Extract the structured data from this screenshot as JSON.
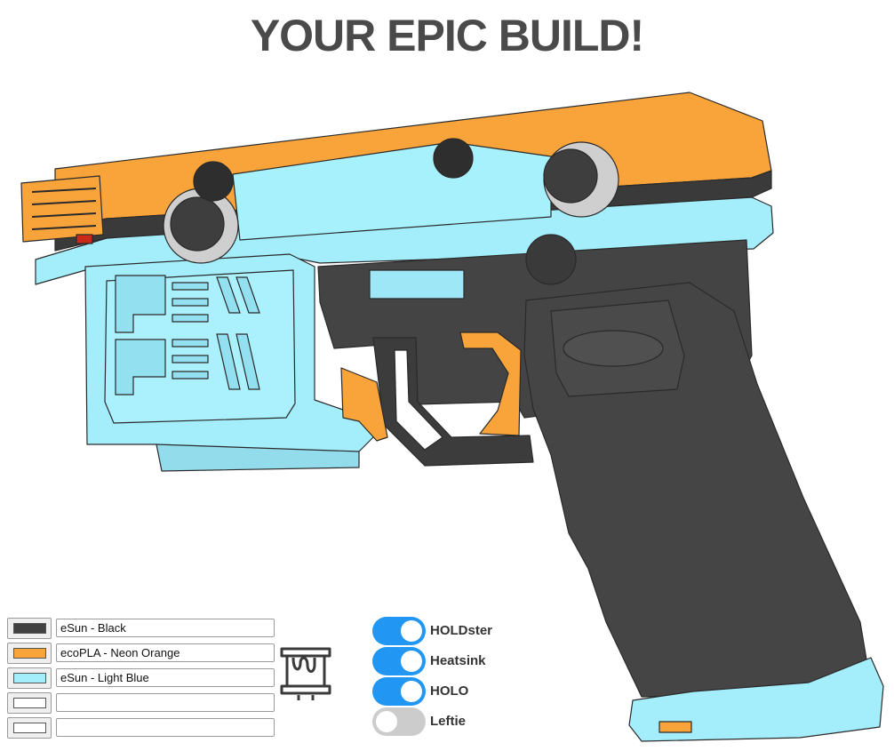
{
  "page": {
    "title": "YOUR EPIC BUILD!"
  },
  "colors": {
    "black": "#414141",
    "orange": "#f9a43b",
    "light_blue": "#a4eefc",
    "empty": "#ffffff"
  },
  "filaments": [
    {
      "name": "eSun - Black",
      "color": "#414141"
    },
    {
      "name": "ecoPLA - Neon Orange",
      "color": "#f9a43b"
    },
    {
      "name": "eSun - Light Blue",
      "color": "#a4eefc"
    },
    {
      "name": "",
      "color": "#ffffff"
    },
    {
      "name": "",
      "color": "#ffffff"
    }
  ],
  "spool_icon": "filament-spool-icon",
  "options": [
    {
      "label": "HOLDster",
      "checked": true
    },
    {
      "label": "Heatsink",
      "checked": true
    },
    {
      "label": "HOLO",
      "checked": true
    },
    {
      "label": "Leftie",
      "checked": false
    }
  ]
}
